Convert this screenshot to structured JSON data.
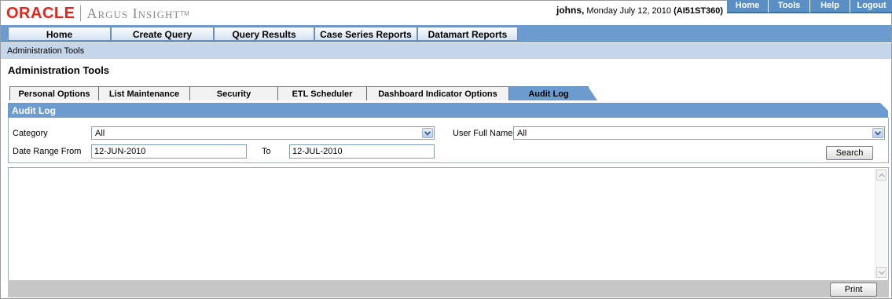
{
  "header": {
    "logo_brand": "ORACLE",
    "logo_registered": "",
    "logo_product": "Argus Insight",
    "logo_tm": "TM",
    "user_name": "johns,",
    "date_text": " Monday July 12, 2010 ",
    "server": "(AI51ST360)"
  },
  "global_links": [
    "Home",
    "Tools",
    "Help",
    "Logout"
  ],
  "top_nav": [
    "Home",
    "Create Query",
    "Query Results",
    "Case Series Reports",
    "Datamart Reports"
  ],
  "breadcrumb": "Administration Tools",
  "page_title": "Administration Tools",
  "tabs": [
    "Personal Options",
    "List Maintenance",
    "Security",
    "ETL Scheduler",
    "Dashboard Indicator Options",
    "Audit Log"
  ],
  "active_tab": "Audit Log",
  "panel": {
    "title": "Audit Log",
    "category_label": "Category",
    "category_value": "All",
    "user_full_name_label": "User Full Name",
    "user_full_name_value": "All",
    "date_range_from_label": "Date Range From",
    "date_from_value": "12-JUN-2010",
    "to_label": "To",
    "date_to_value": "12-JUL-2010",
    "search_button": "Search"
  },
  "footer": {
    "print_button": "Print"
  },
  "colors": {
    "accent_blue": "#6c9ccf",
    "breadcrumb_bg": "#c5d6ea",
    "oracle_red": "#e3251b",
    "footer_gray": "#c6c6c6"
  },
  "icons": [
    "chevron-down-icon",
    "scroll-up-icon",
    "scroll-down-icon"
  ]
}
